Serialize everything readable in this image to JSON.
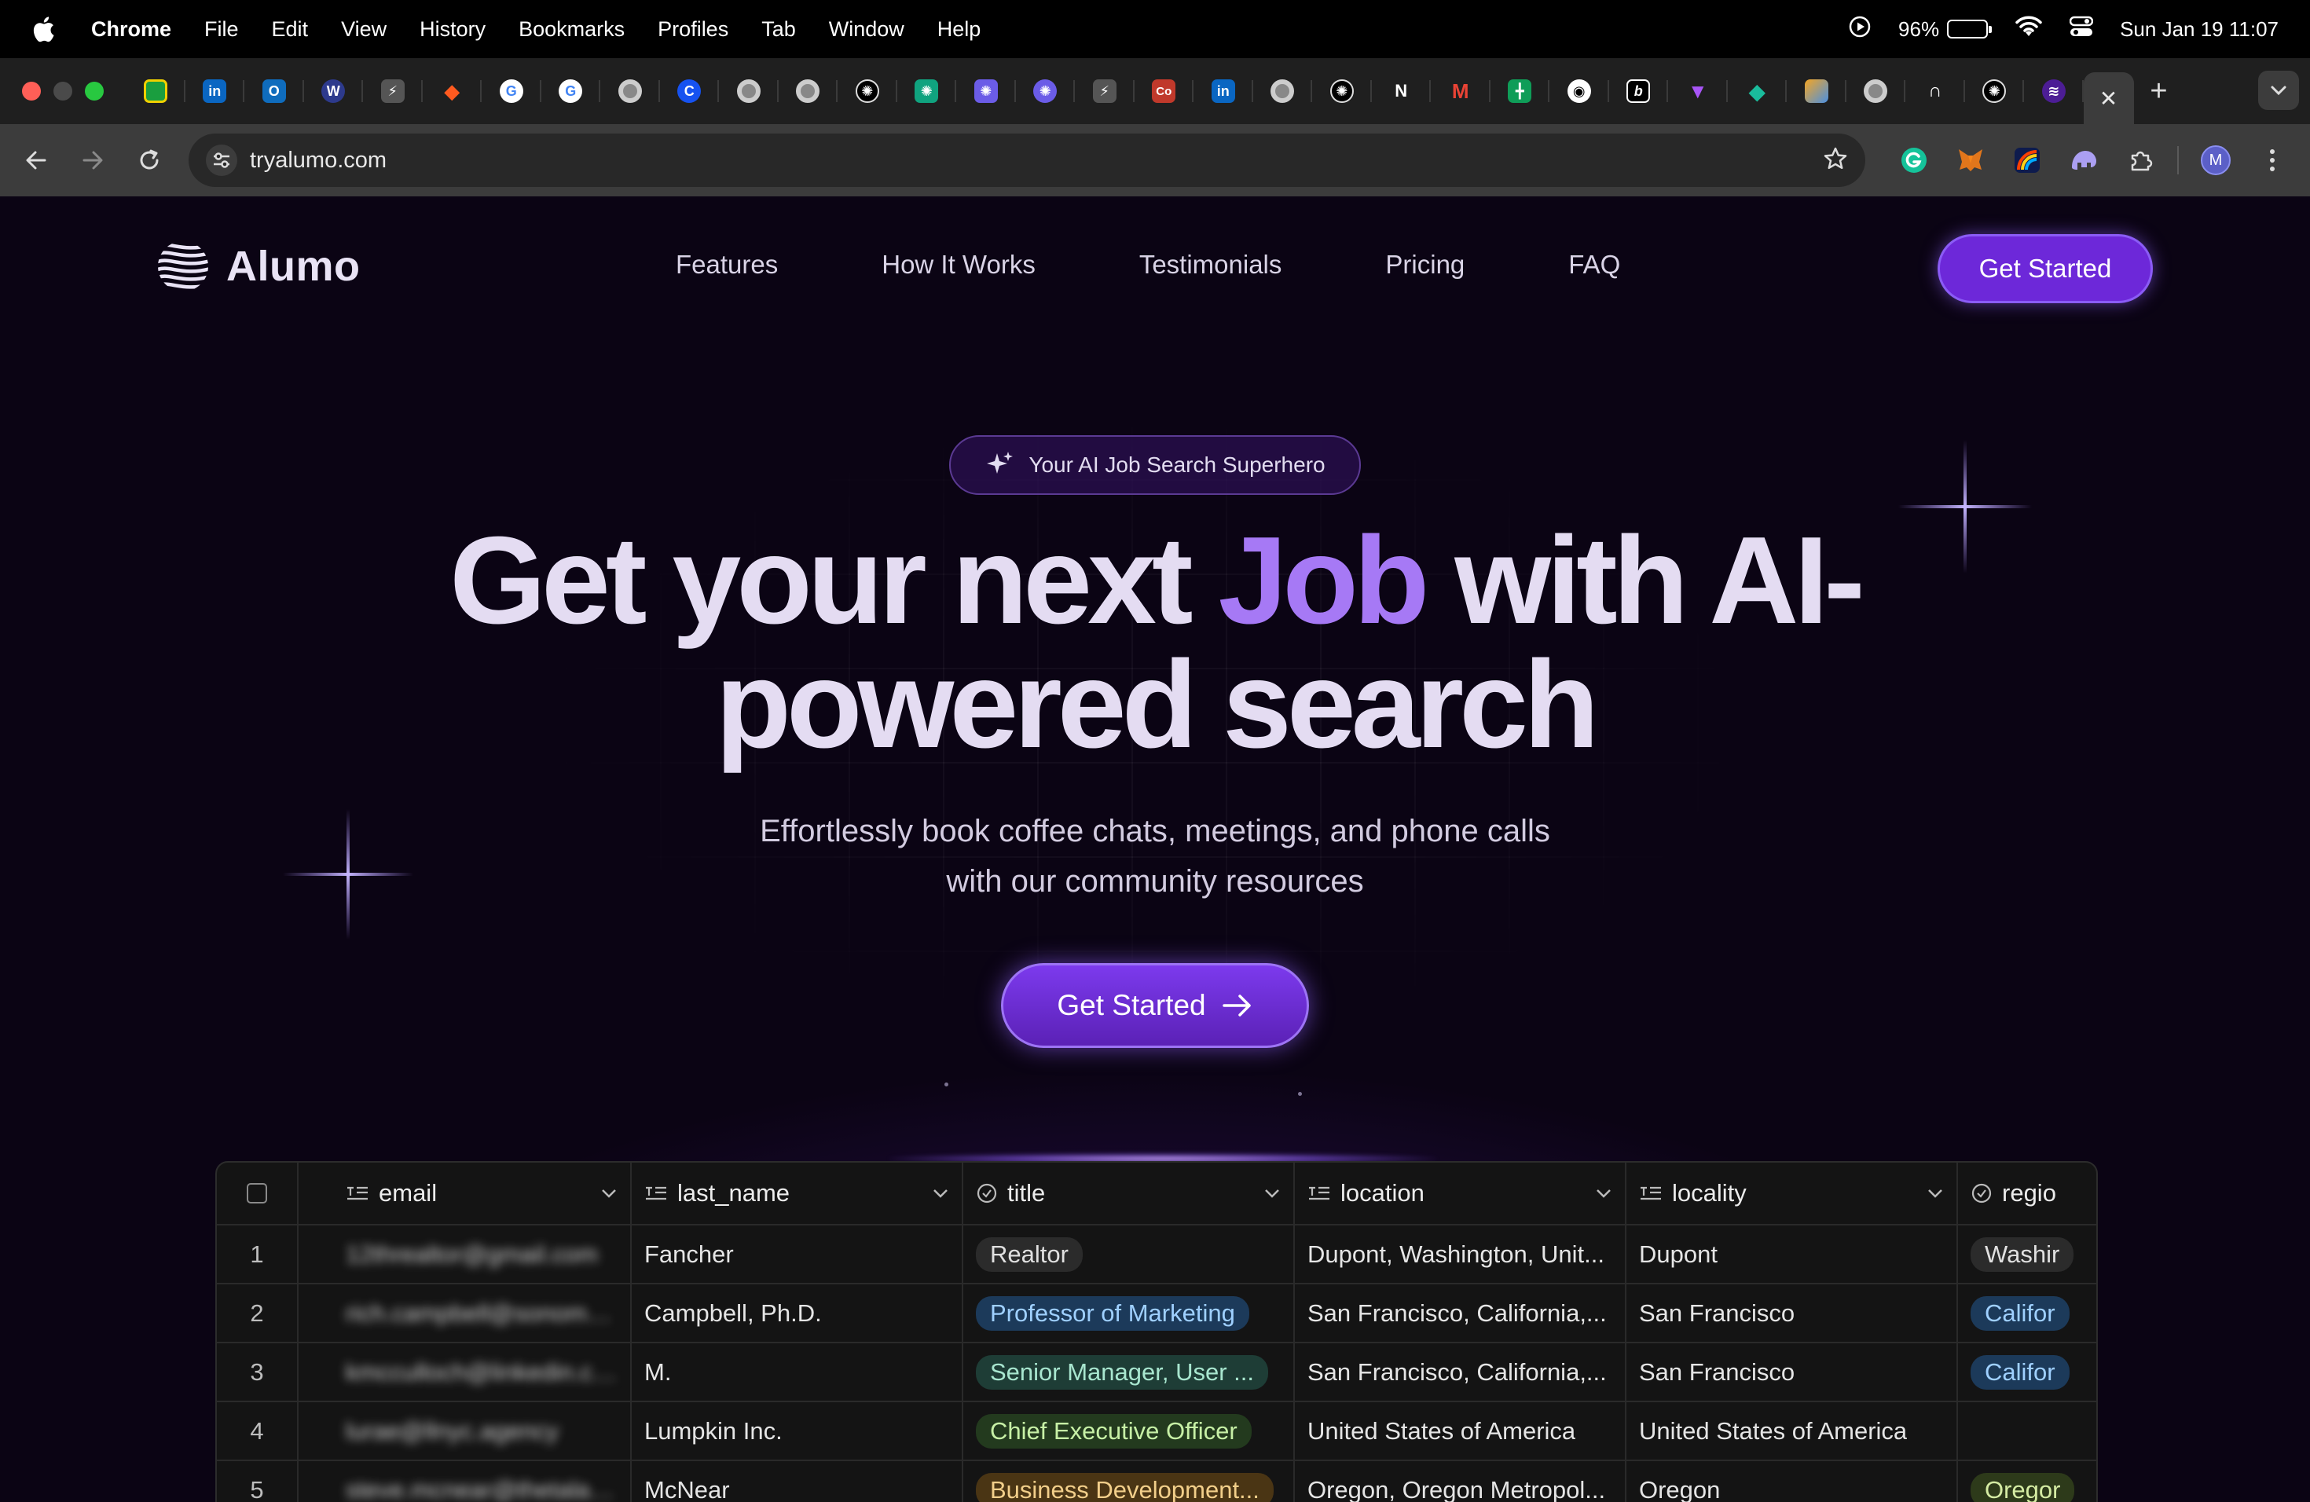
{
  "menubar": {
    "app": "Chrome",
    "items": [
      "File",
      "Edit",
      "View",
      "History",
      "Bookmarks",
      "Profiles",
      "Tab",
      "Window",
      "Help"
    ],
    "battery": "96%",
    "datetime": "Sun Jan 19  11:07"
  },
  "browser": {
    "url": "tryalumo.com",
    "profile_initial": "M",
    "tab_icons": [
      "green-square",
      "linkedin",
      "outlook",
      "circle-blue",
      "bolt",
      "fox-orange",
      "google",
      "google",
      "chrome",
      "coinbase",
      "chrome",
      "chrome",
      "openai",
      "chatgpt-green",
      "purple-app",
      "purple-circle",
      "bolt",
      "coursera",
      "linkedin",
      "chrome",
      "openai",
      "stripe-like",
      "gmail",
      "sheets",
      "github",
      "bold-b",
      "vue",
      "diamond",
      "layers",
      "chrome",
      "loop",
      "openai",
      "alumo"
    ]
  },
  "nav": {
    "brand": "Alumo",
    "links": [
      "Features",
      "How It Works",
      "Testimonials",
      "Pricing",
      "FAQ"
    ],
    "cta": "Get Started"
  },
  "hero": {
    "badge": "Your AI Job Search Superhero",
    "headline_part1": "Get your next ",
    "headline_accent": "Job",
    "headline_part2": " with AI-",
    "headline_line2": "powered search",
    "subtitle_line1": "Effortlessly book coffee chats, meetings, and phone calls",
    "subtitle_line2": "with our community resources",
    "cta": "Get Started"
  },
  "table": {
    "columns": [
      "email",
      "last_name",
      "title",
      "location",
      "locality",
      "regio"
    ],
    "rows": [
      {
        "n": "1",
        "email": "12threaltor@gmail.com",
        "last_name": "Fancher",
        "title": "Realtor",
        "title_color": "gray",
        "location": "Dupont, Washington, Unit...",
        "locality": "Dupont",
        "region": "Washir",
        "region_color": "gray"
      },
      {
        "n": "2",
        "email": "rich.campbell@sonoma.e...",
        "last_name": "Campbell, Ph.D.",
        "title": "Professor of Marketing",
        "title_color": "blue",
        "location": "San Francisco, California,...",
        "locality": "San Francisco",
        "region": "Califor",
        "region_color": "blue"
      },
      {
        "n": "3",
        "email": "kmcculloch@linkedin.com",
        "last_name": "M.",
        "title": "Senior Manager, User ...",
        "title_color": "teal",
        "location": "San Francisco, California,...",
        "locality": "San Francisco",
        "region": "Califor",
        "region_color": "blue"
      },
      {
        "n": "4",
        "email": "lurae@llnyc.agency",
        "last_name": "Lumpkin Inc.",
        "title": "Chief Executive Officer",
        "title_color": "green",
        "location": "United States of America",
        "locality": "United States of America",
        "region": "",
        "region_color": "none"
      },
      {
        "n": "5",
        "email": "steve.mcnear@thetalake...",
        "last_name": "McNear",
        "title": "Business Development...",
        "title_color": "brown",
        "location": "Oregon, Oregon Metropol...",
        "locality": "Oregon",
        "region": "Oregor",
        "region_color": "olive"
      }
    ]
  }
}
